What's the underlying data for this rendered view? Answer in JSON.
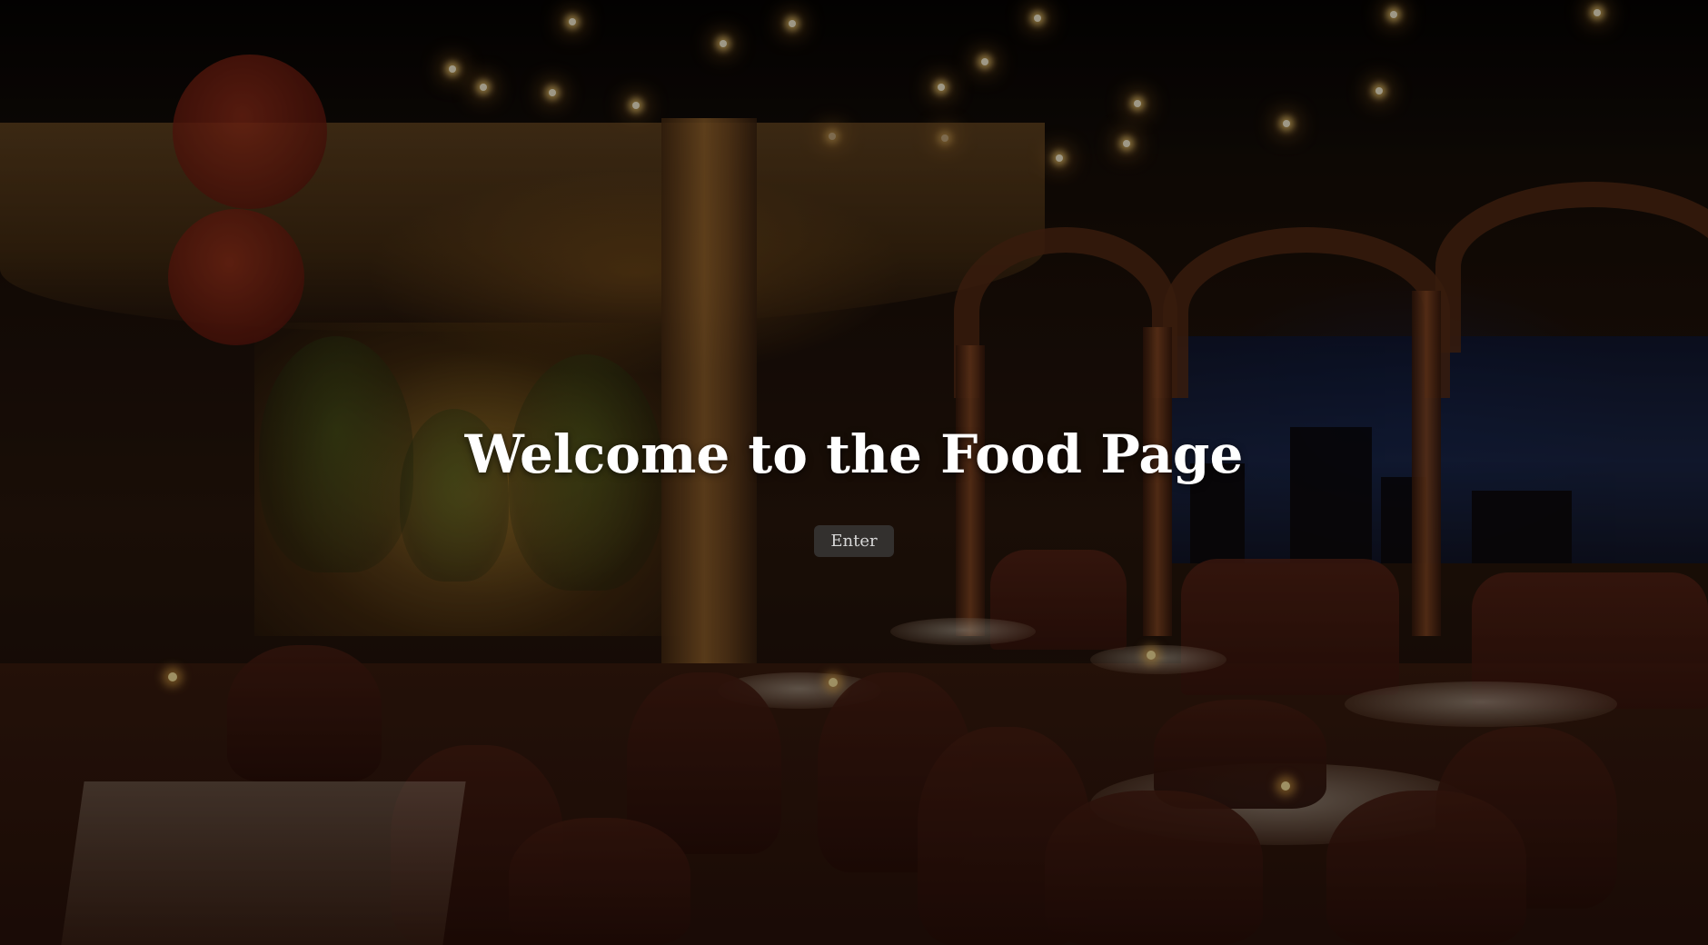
{
  "hero": {
    "title": "Welcome to the Food Page",
    "enter_label": "Enter"
  },
  "colors": {
    "overlay": "#000000",
    "title_text": "#ffffff",
    "button_background": "#3c3c3c",
    "button_text": "#d8d8d8"
  },
  "background_image": "dark-restaurant-interior-photo"
}
